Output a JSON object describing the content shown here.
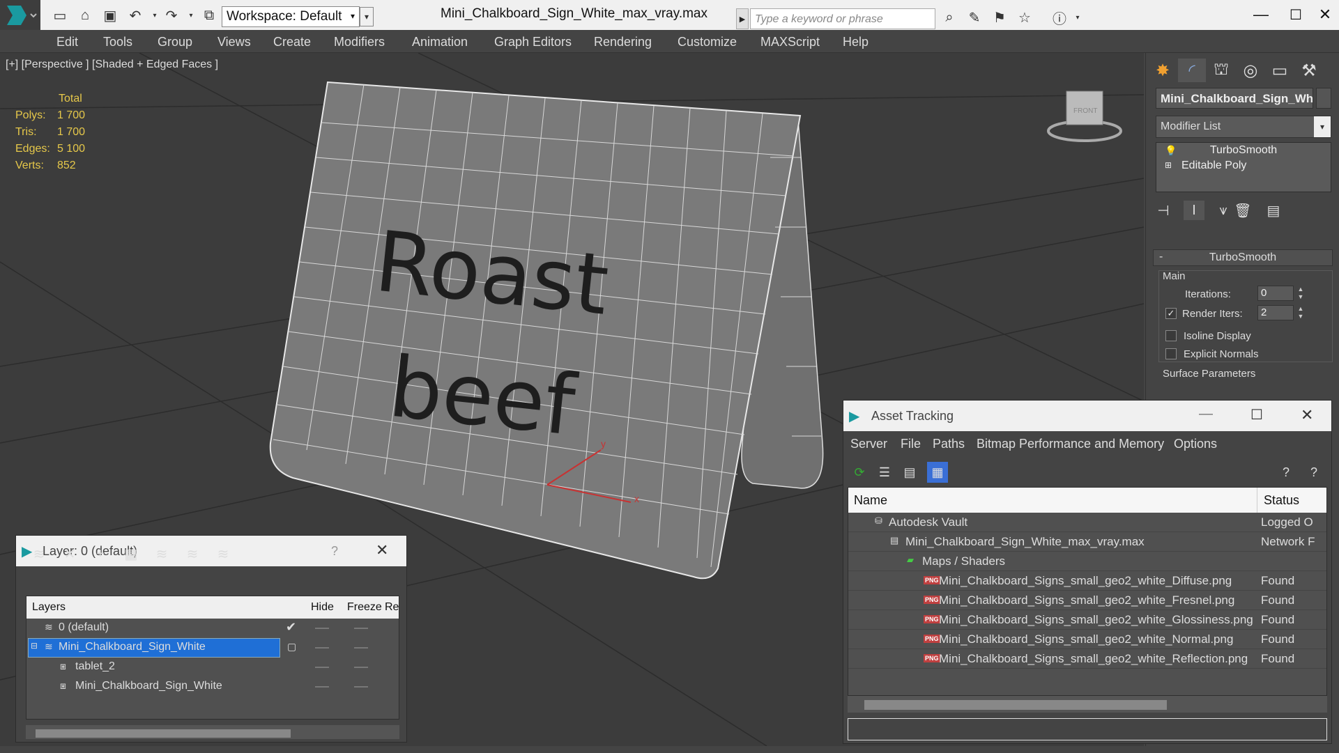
{
  "titlebar": {
    "workspace": "Workspace: Default",
    "document_title": "Mini_Chalkboard_Sign_White_max_vray.max",
    "search_placeholder": "Type a keyword or phrase"
  },
  "menu": [
    "Edit",
    "Tools",
    "Group",
    "Views",
    "Create",
    "Modifiers",
    "Animation",
    "Graph Editors",
    "Rendering",
    "Customize",
    "MAXScript",
    "Help"
  ],
  "viewport": {
    "label": "[+] [Perspective ] [Shaded + Edged Faces ]",
    "stats_header": "Total",
    "stats": [
      {
        "label": "Polys:",
        "value": "1 700"
      },
      {
        "label": "Tris:",
        "value": "1 700"
      },
      {
        "label": "Edges:",
        "value": "5 100"
      },
      {
        "label": "Verts:",
        "value": "852"
      }
    ],
    "sign_text_line1": "Roast",
    "sign_text_line2": "beef",
    "axis_x": "x",
    "axis_y": "y",
    "viewcube_label": "FRONT"
  },
  "command_panel": {
    "object_name": "Mini_Chalkboard_Sign_White",
    "modifier_list": "Modifier List",
    "stack": [
      "TurboSmooth",
      "Editable Poly"
    ],
    "rollout_title": "TurboSmooth",
    "group_main": "Main",
    "iterations_label": "Iterations:",
    "iterations_value": "0",
    "render_iters_label": "Render Iters:",
    "render_iters_value": "2",
    "isoline_label": "Isoline Display",
    "explicit_normals_label": "Explicit Normals",
    "surface_params": "Surface Parameters"
  },
  "layer_dialog": {
    "title": "Layer: 0 (default)",
    "help": "?",
    "columns": [
      "Layers",
      "Hide",
      "Freeze",
      "Re"
    ],
    "rows": [
      {
        "name": "0 (default)",
        "active": true
      },
      {
        "name": "Mini_Chalkboard_Sign_White",
        "selected": true
      },
      {
        "name": "tablet_2"
      },
      {
        "name": "Mini_Chalkboard_Sign_White"
      }
    ]
  },
  "asset_dialog": {
    "title": "Asset Tracking",
    "menu": [
      "Server",
      "File",
      "Paths",
      "Bitmap Performance and Memory",
      "Options"
    ],
    "columns": [
      "Name",
      "Status"
    ],
    "rows": [
      {
        "name": "Autodesk Vault",
        "status": "Logged O"
      },
      {
        "name": "Mini_Chalkboard_Sign_White_max_vray.max",
        "status": "Network F"
      },
      {
        "name": "Maps / Shaders",
        "status": ""
      },
      {
        "name": "Mini_Chalkboard_Signs_small_geo2_white_Diffuse.png",
        "status": "Found"
      },
      {
        "name": "Mini_Chalkboard_Signs_small_geo2_white_Fresnel.png",
        "status": "Found"
      },
      {
        "name": "Mini_Chalkboard_Signs_small_geo2_white_Glossiness.png",
        "status": "Found"
      },
      {
        "name": "Mini_Chalkboard_Signs_small_geo2_white_Normal.png",
        "status": "Found"
      },
      {
        "name": "Mini_Chalkboard_Signs_small_geo2_white_Reflection.png",
        "status": "Found"
      }
    ],
    "png_badge": "PNG"
  }
}
